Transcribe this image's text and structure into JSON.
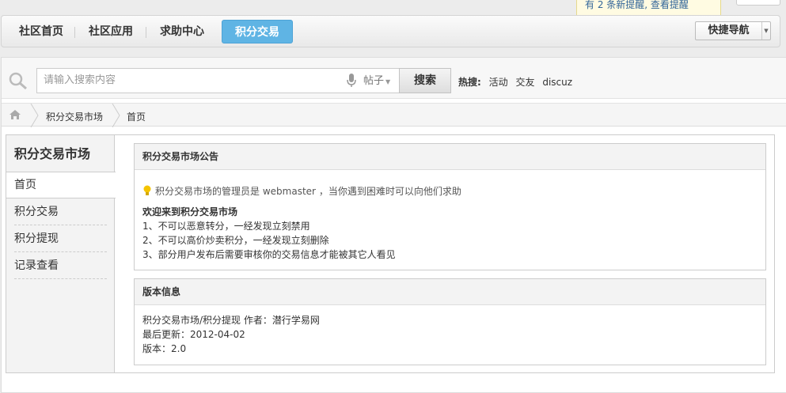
{
  "notice": {
    "text": "有 2 条新提醒, 查看提醒"
  },
  "nav": {
    "items": [
      {
        "label": "社区首页"
      },
      {
        "label": "社区应用"
      },
      {
        "label": "求助中心"
      },
      {
        "label": "积分交易"
      }
    ],
    "quick_nav": "快捷导航"
  },
  "search": {
    "placeholder": "请输入搜索内容",
    "type": "帖子",
    "button": "搜索",
    "hot_label": "热搜:",
    "hot_keywords": [
      "活动",
      "交友",
      "discuz"
    ]
  },
  "breadcrumb": {
    "items": [
      "积分交易市场",
      "首页"
    ]
  },
  "sidebar": {
    "title": "积分交易市场",
    "items": [
      "首页",
      "积分交易",
      "积分提现",
      "记录查看"
    ]
  },
  "announcement": {
    "title": "积分交易市场公告",
    "admin_prefix": "积分交易市场的管理员是",
    "admin_name": "webmaster",
    "admin_suffix": "，当你遇到困难时可以向他们求助",
    "welcome": "欢迎来到积分交易市场",
    "rules": [
      "1、不可以恶意转分，一经发现立刻禁用",
      "2、不可以高价炒卖积分，一经发现立刻删除",
      "3、部分用户发布后需要审核你的交易信息才能被其它人看见"
    ]
  },
  "version": {
    "title": "版本信息",
    "lines": [
      "积分交易市场/积分提现 作者：潜行学易网",
      "最后更新：2012-04-02",
      "版本：2.0"
    ]
  },
  "colors": {
    "accent": "#5fb4e4",
    "notice_bg": "#fffbe2"
  }
}
